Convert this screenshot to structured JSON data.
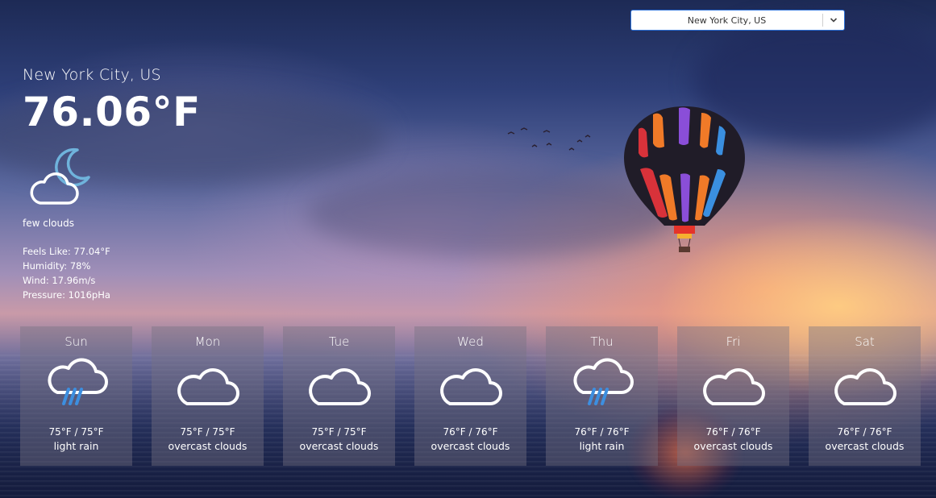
{
  "search": {
    "selected_city": "New York City, US"
  },
  "current": {
    "location": "New York City, US",
    "temperature": "76.06°F",
    "icon": "few-clouds-night-icon",
    "description": "few clouds",
    "feels_like": "Feels Like: 77.04°F",
    "humidity": "Humidity: 78%",
    "wind": "Wind: 17.96m/s",
    "pressure": "Pressure: 1016pHa"
  },
  "forecast": [
    {
      "day": "Sun",
      "icon": "rain-cloud-icon",
      "range": "75°F / 75°F",
      "condition": "light rain"
    },
    {
      "day": "Mon",
      "icon": "cloud-icon",
      "range": "75°F / 75°F",
      "condition": "overcast clouds"
    },
    {
      "day": "Tue",
      "icon": "cloud-icon",
      "range": "75°F / 75°F",
      "condition": "overcast clouds"
    },
    {
      "day": "Wed",
      "icon": "cloud-icon",
      "range": "76°F / 76°F",
      "condition": "overcast clouds"
    },
    {
      "day": "Thu",
      "icon": "rain-cloud-icon",
      "range": "76°F / 76°F",
      "condition": "light rain"
    },
    {
      "day": "Fri",
      "icon": "cloud-icon",
      "range": "76°F / 76°F",
      "condition": "overcast clouds"
    },
    {
      "day": "Sat",
      "icon": "cloud-icon",
      "range": "76°F / 76°F",
      "condition": "overcast clouds"
    }
  ],
  "colors": {
    "select_border": "#2b6fd6",
    "rain_streak": "#3d8fe0",
    "moon": "#6fb3dc"
  }
}
